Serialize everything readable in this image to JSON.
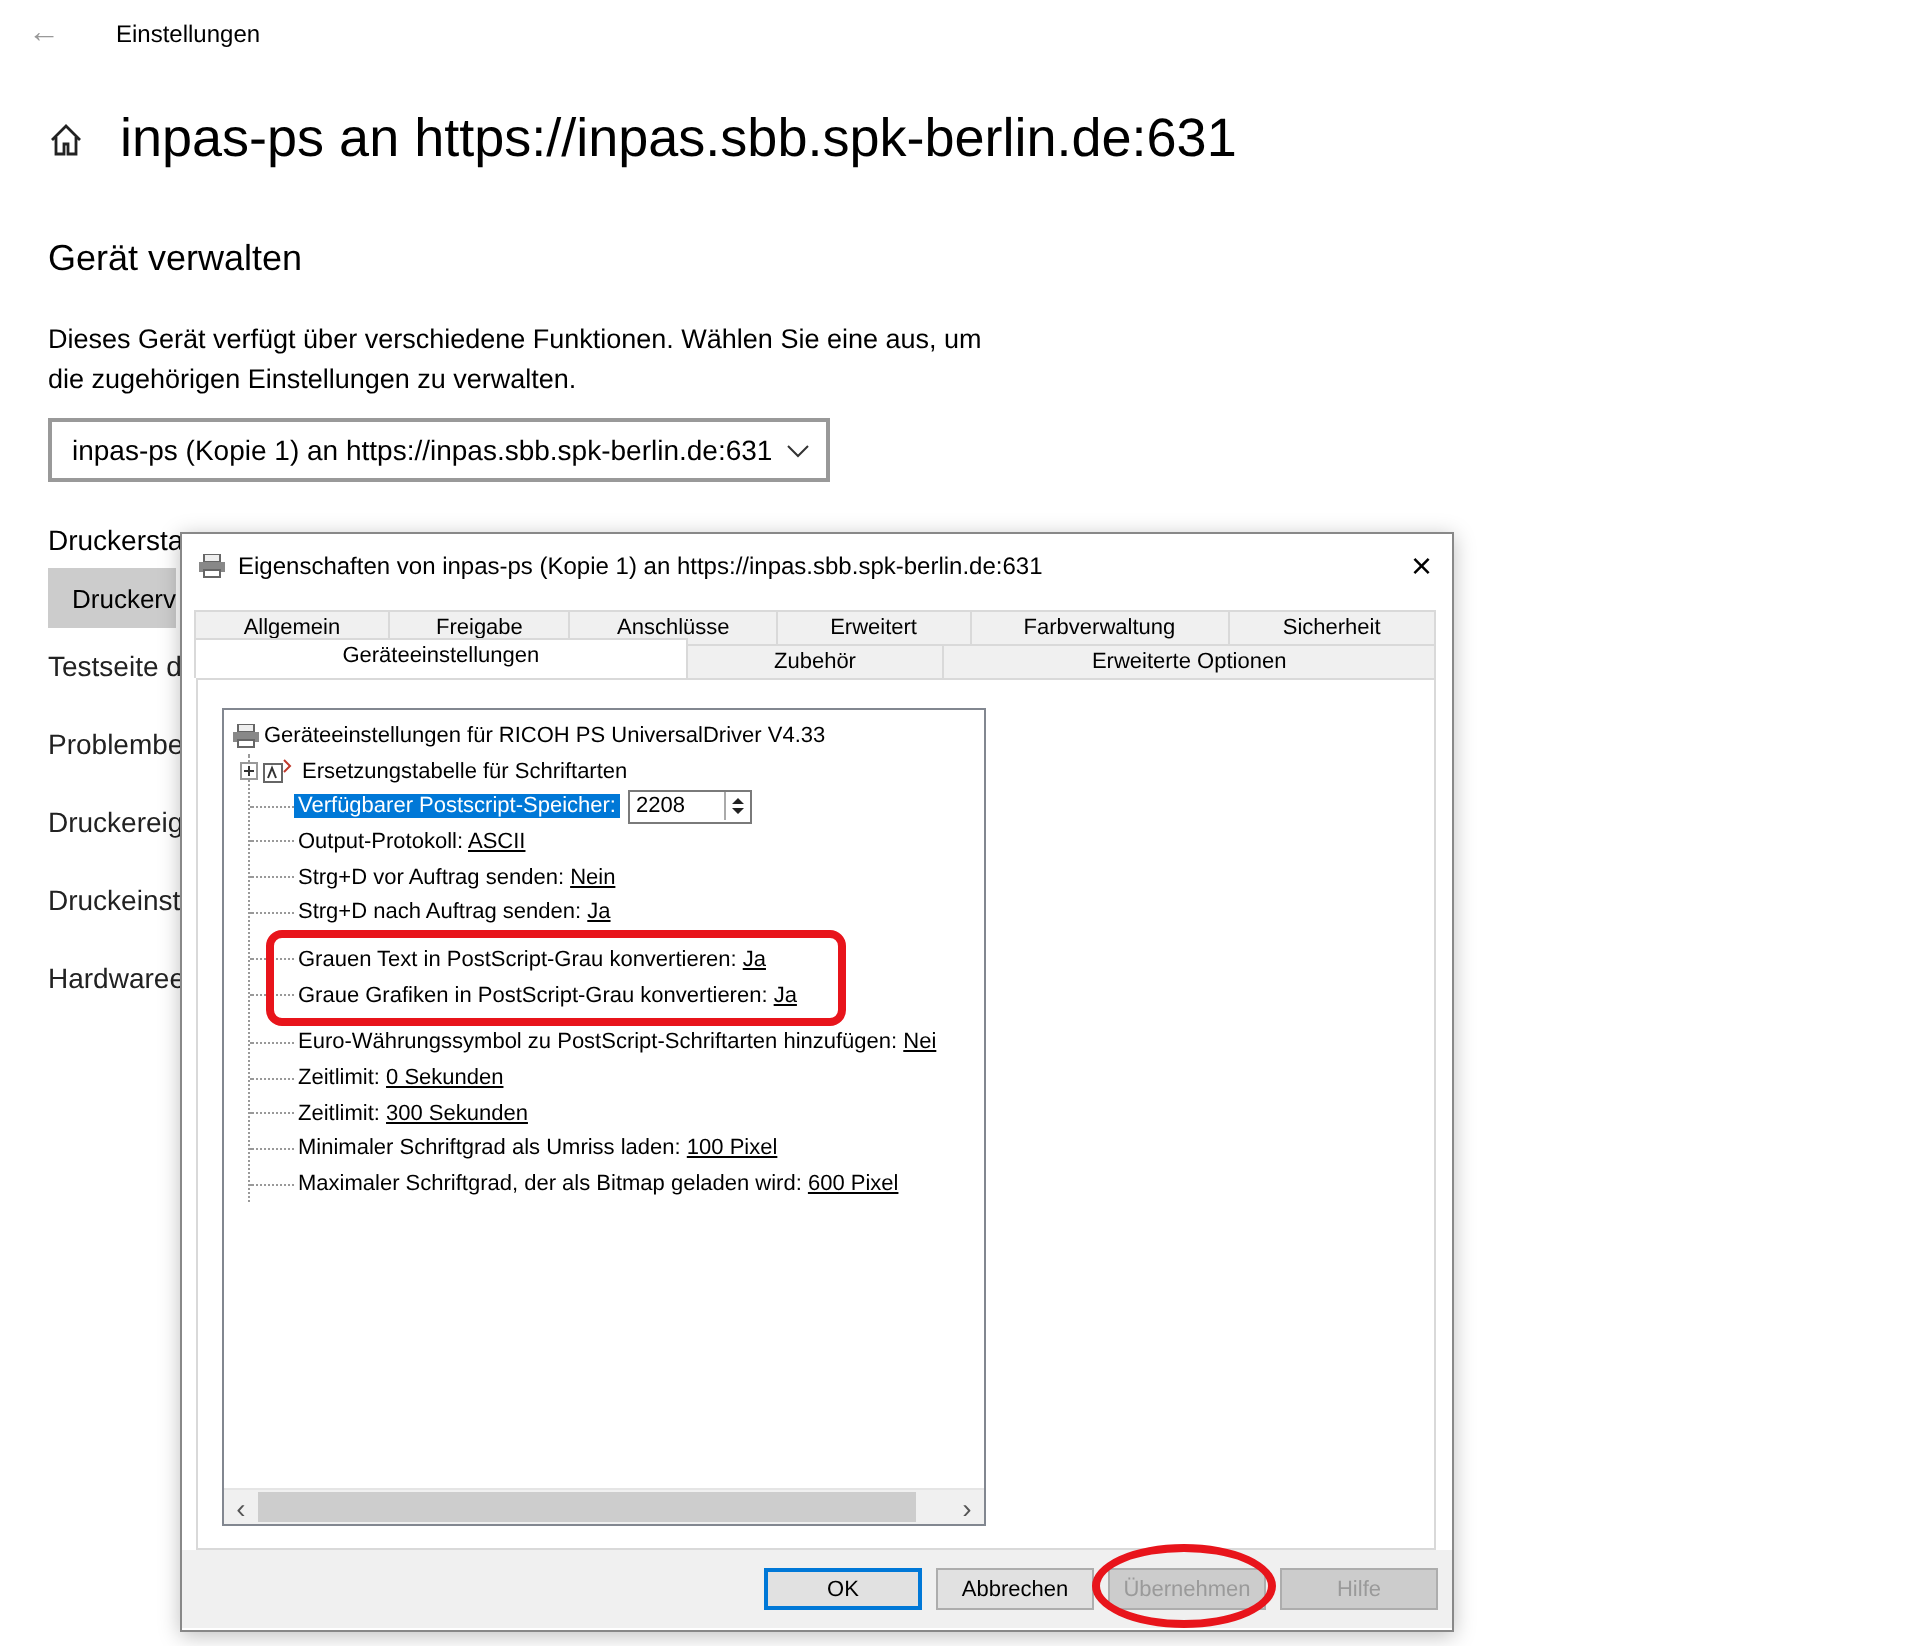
{
  "header": {
    "back": "←",
    "title": "Einstellungen"
  },
  "page": {
    "title": "inpas-ps an https://inpas.sbb.spk-berlin.de:631",
    "section": "Gerät verwalten",
    "description": "Dieses Gerät verfügt über verschiedene Funktionen. Wählen Sie eine aus, um die zugehörigen Einstellungen zu verwalten.",
    "device_select": "inpas-ps (Kopie 1) an https://inpas.sbb.spk-berlin.de:631",
    "status_label": "Druckersta",
    "links": [
      {
        "label": "Druckerv",
        "kind": "button"
      },
      {
        "label": "Testseite d",
        "kind": "link"
      },
      {
        "label": "Problembe",
        "kind": "link"
      },
      {
        "label": "Druckereig",
        "kind": "link"
      },
      {
        "label": "Druckeinst",
        "kind": "link"
      },
      {
        "label": "Hardwaree",
        "kind": "link"
      }
    ]
  },
  "dialog": {
    "title": "Eigenschaften von inpas-ps (Kopie 1) an https://inpas.sbb.spk-berlin.de:631",
    "close": "×",
    "tab_rows": [
      [
        {
          "label": "Allgemein",
          "selected": false
        },
        {
          "label": "Freigabe",
          "selected": false
        },
        {
          "label": "Anschlüsse",
          "selected": false
        },
        {
          "label": "Erweitert",
          "selected": false
        },
        {
          "label": "Farbverwaltung",
          "selected": false
        },
        {
          "label": "Sicherheit",
          "selected": false
        }
      ],
      [
        {
          "label": "Geräteeinstellungen",
          "selected": true
        },
        {
          "label": "Zubehör",
          "selected": false
        },
        {
          "label": "Erweiterte Optionen",
          "selected": false
        }
      ]
    ],
    "tree": {
      "root": "Geräteeinstellungen für RICOH PS UniversalDriver V4.33",
      "items": [
        {
          "kind": "group",
          "label": "Ersetzungstabelle für Schriftarten",
          "expanded": false,
          "selected": false,
          "annotated": false
        },
        {
          "kind": "spin",
          "label": "Verfügbarer Postscript-Speicher:",
          "value": "2208",
          "selected": true,
          "annotated": false
        },
        {
          "kind": "option",
          "label": "Output-Protokoll:",
          "value": "ASCII",
          "selected": false,
          "annotated": false
        },
        {
          "kind": "option",
          "label": "Strg+D vor Auftrag senden:",
          "value": "Nein",
          "selected": false,
          "annotated": false
        },
        {
          "kind": "option",
          "label": "Strg+D nach Auftrag senden:",
          "value": "Ja",
          "selected": false,
          "annotated": false
        },
        {
          "kind": "option",
          "label": "Grauen Text in PostScript-Grau konvertieren:",
          "value": "Ja",
          "selected": false,
          "annotated": true
        },
        {
          "kind": "option",
          "label": "Graue Grafiken in PostScript-Grau konvertieren:",
          "value": "Ja",
          "selected": false,
          "annotated": true
        },
        {
          "kind": "option",
          "label": "Euro-Währungssymbol zu PostScript-Schriftarten hinzufügen:",
          "value": "Nei",
          "selected": false,
          "annotated": false
        },
        {
          "kind": "option",
          "label": "Zeitlimit:",
          "value": "0 Sekunden",
          "selected": false,
          "annotated": false
        },
        {
          "kind": "option",
          "label": "Zeitlimit:",
          "value": "300 Sekunden",
          "selected": false,
          "annotated": false
        },
        {
          "kind": "option",
          "label": "Minimaler Schriftgrad als Umriss laden:",
          "value": "100 Pixel",
          "selected": false,
          "annotated": false
        },
        {
          "kind": "option",
          "label": "Maximaler Schriftgrad, der als Bitmap geladen wird:",
          "value": "600 Pixel",
          "selected": false,
          "annotated": false
        }
      ],
      "scroll_left": "‹",
      "scroll_right": "›"
    },
    "buttons": [
      {
        "label": "OK",
        "default": true,
        "disabled": false,
        "annotated": false
      },
      {
        "label": "Abbrechen",
        "default": false,
        "disabled": false,
        "annotated": false
      },
      {
        "label": "Übernehmen",
        "default": false,
        "disabled": true,
        "annotated": true
      },
      {
        "label": "Hilfe",
        "default": false,
        "disabled": true,
        "annotated": false
      }
    ]
  }
}
